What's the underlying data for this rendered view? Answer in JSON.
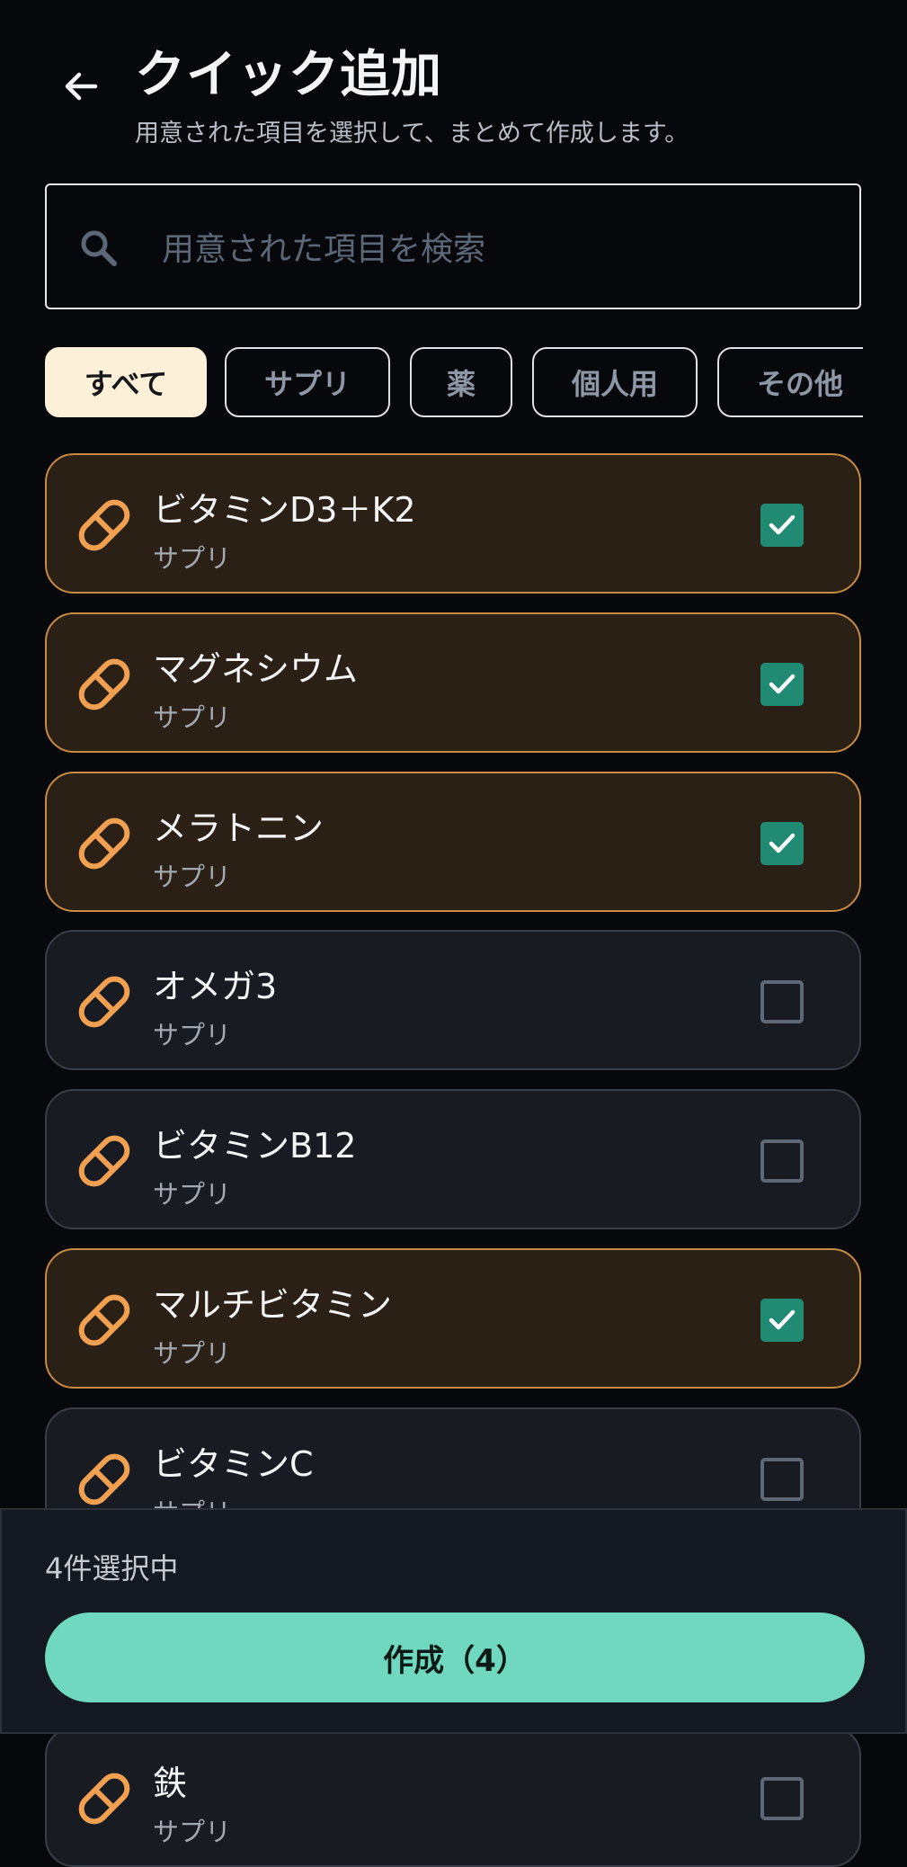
{
  "header": {
    "title": "クイック追加",
    "subtitle": "用意された項目を選択して、まとめて作成します。"
  },
  "search": {
    "placeholder": "用意された項目を検索",
    "value": ""
  },
  "filters": [
    {
      "label": "すべて",
      "active": true
    },
    {
      "label": "サプリ",
      "active": false
    },
    {
      "label": "薬",
      "active": false
    },
    {
      "label": "個人用",
      "active": false
    },
    {
      "label": "その他",
      "active": false
    }
  ],
  "items": [
    {
      "name": "ビタミンD3＋K2",
      "category": "サプリ",
      "selected": true
    },
    {
      "name": "マグネシウム",
      "category": "サプリ",
      "selected": true
    },
    {
      "name": "メラトニン",
      "category": "サプリ",
      "selected": true
    },
    {
      "name": "オメガ3",
      "category": "サプリ",
      "selected": false
    },
    {
      "name": "ビタミンB12",
      "category": "サプリ",
      "selected": false
    },
    {
      "name": "マルチビタミン",
      "category": "サプリ",
      "selected": true
    },
    {
      "name": "ビタミンC",
      "category": "サプリ",
      "selected": false
    },
    {
      "name": "鉄",
      "category": "サプリ",
      "selected": false
    }
  ],
  "footer": {
    "selected_text": "4件選択中",
    "create_label": "作成（4）"
  },
  "colors": {
    "accent_orange": "#f0a050",
    "check_green": "#208a72",
    "button_mint": "#6fd8be",
    "chip_active_bg": "#fdf0d8"
  }
}
